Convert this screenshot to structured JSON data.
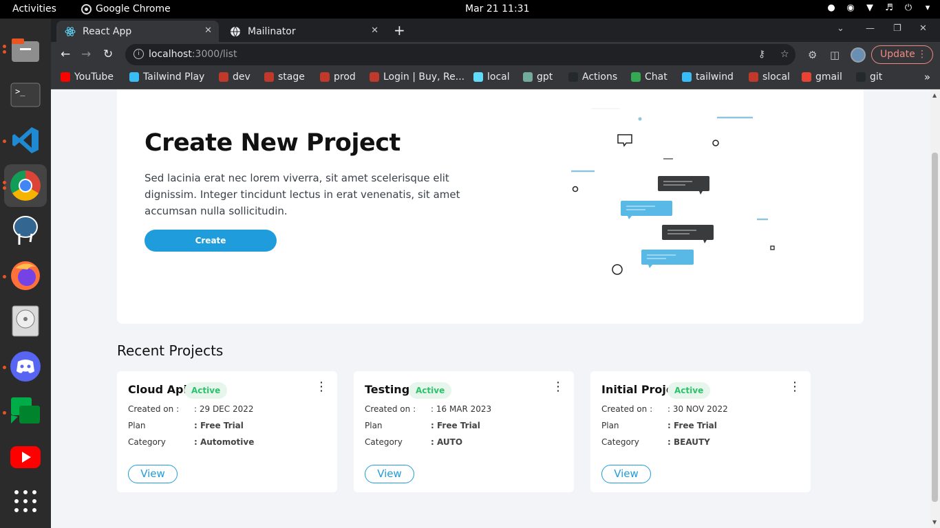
{
  "topbar": {
    "activities": "Activities",
    "app_name": "Google Chrome",
    "clock": "Mar 21  11:31"
  },
  "browser": {
    "tabs": [
      {
        "label": "React App",
        "icon": "react-icon",
        "active": true
      },
      {
        "label": "Mailinator",
        "icon": "globe-icon",
        "active": false
      }
    ],
    "url_host": "localhost",
    "url_rest": ":3000/list",
    "update_label": "Update",
    "bookmarks": [
      {
        "label": "YouTube",
        "icon": "youtube-icon",
        "color": "#ff0000"
      },
      {
        "label": "Tailwind Play",
        "icon": "tailwind-icon",
        "color": "#38bdf8"
      },
      {
        "label": "dev",
        "icon": "bookmark-icon",
        "color": "#c0392b"
      },
      {
        "label": "stage",
        "icon": "bookmark-icon",
        "color": "#c0392b"
      },
      {
        "label": "prod",
        "icon": "bookmark-icon",
        "color": "#c0392b"
      },
      {
        "label": "Login | Buy, Re...",
        "icon": "bookmark-icon",
        "color": "#c0392b"
      },
      {
        "label": "local",
        "icon": "react-icon",
        "color": "#61dafb"
      },
      {
        "label": "gpt",
        "icon": "openai-icon",
        "color": "#74aa9c"
      },
      {
        "label": "Actions",
        "icon": "github-icon",
        "color": "#24292e"
      },
      {
        "label": "Chat",
        "icon": "chat-icon",
        "color": "#34a853"
      },
      {
        "label": "tailwind",
        "icon": "tailwind-icon",
        "color": "#38bdf8"
      },
      {
        "label": "slocal",
        "icon": "bookmark-icon",
        "color": "#c0392b"
      },
      {
        "label": "gmail",
        "icon": "gmail-icon",
        "color": "#ea4335"
      },
      {
        "label": "git",
        "icon": "github-icon",
        "color": "#24292e"
      }
    ]
  },
  "hero": {
    "title": "Create New Project",
    "description": "Sed lacinia erat nec lorem viverra, sit amet scelerisque elit dignissim. Integer tincidunt lectus in erat venenatis, sit amet accumsan nulla sollicitudin.",
    "create_label": "Create"
  },
  "recent": {
    "title": "Recent Projects",
    "labels": {
      "created": "Created on :",
      "plan": "Plan",
      "category": "Category",
      "view": "View"
    },
    "projects": [
      {
        "name": "Cloud Api",
        "status": "Active",
        "created": ": 29 DEC 2022",
        "plan": ": Free Trial",
        "category": ": Automotive"
      },
      {
        "name": "Testing",
        "status": "Active",
        "created": ": 16 MAR 2023",
        "plan": ": Free Trial",
        "category": ": AUTO"
      },
      {
        "name": "Initial Project",
        "status": "Active",
        "created": ": 30 NOV 2022",
        "plan": ": Free Trial",
        "category": ": BEAUTY"
      }
    ]
  },
  "colors": {
    "accent": "#1e9cdc",
    "active_badge": "#2cc26a"
  }
}
